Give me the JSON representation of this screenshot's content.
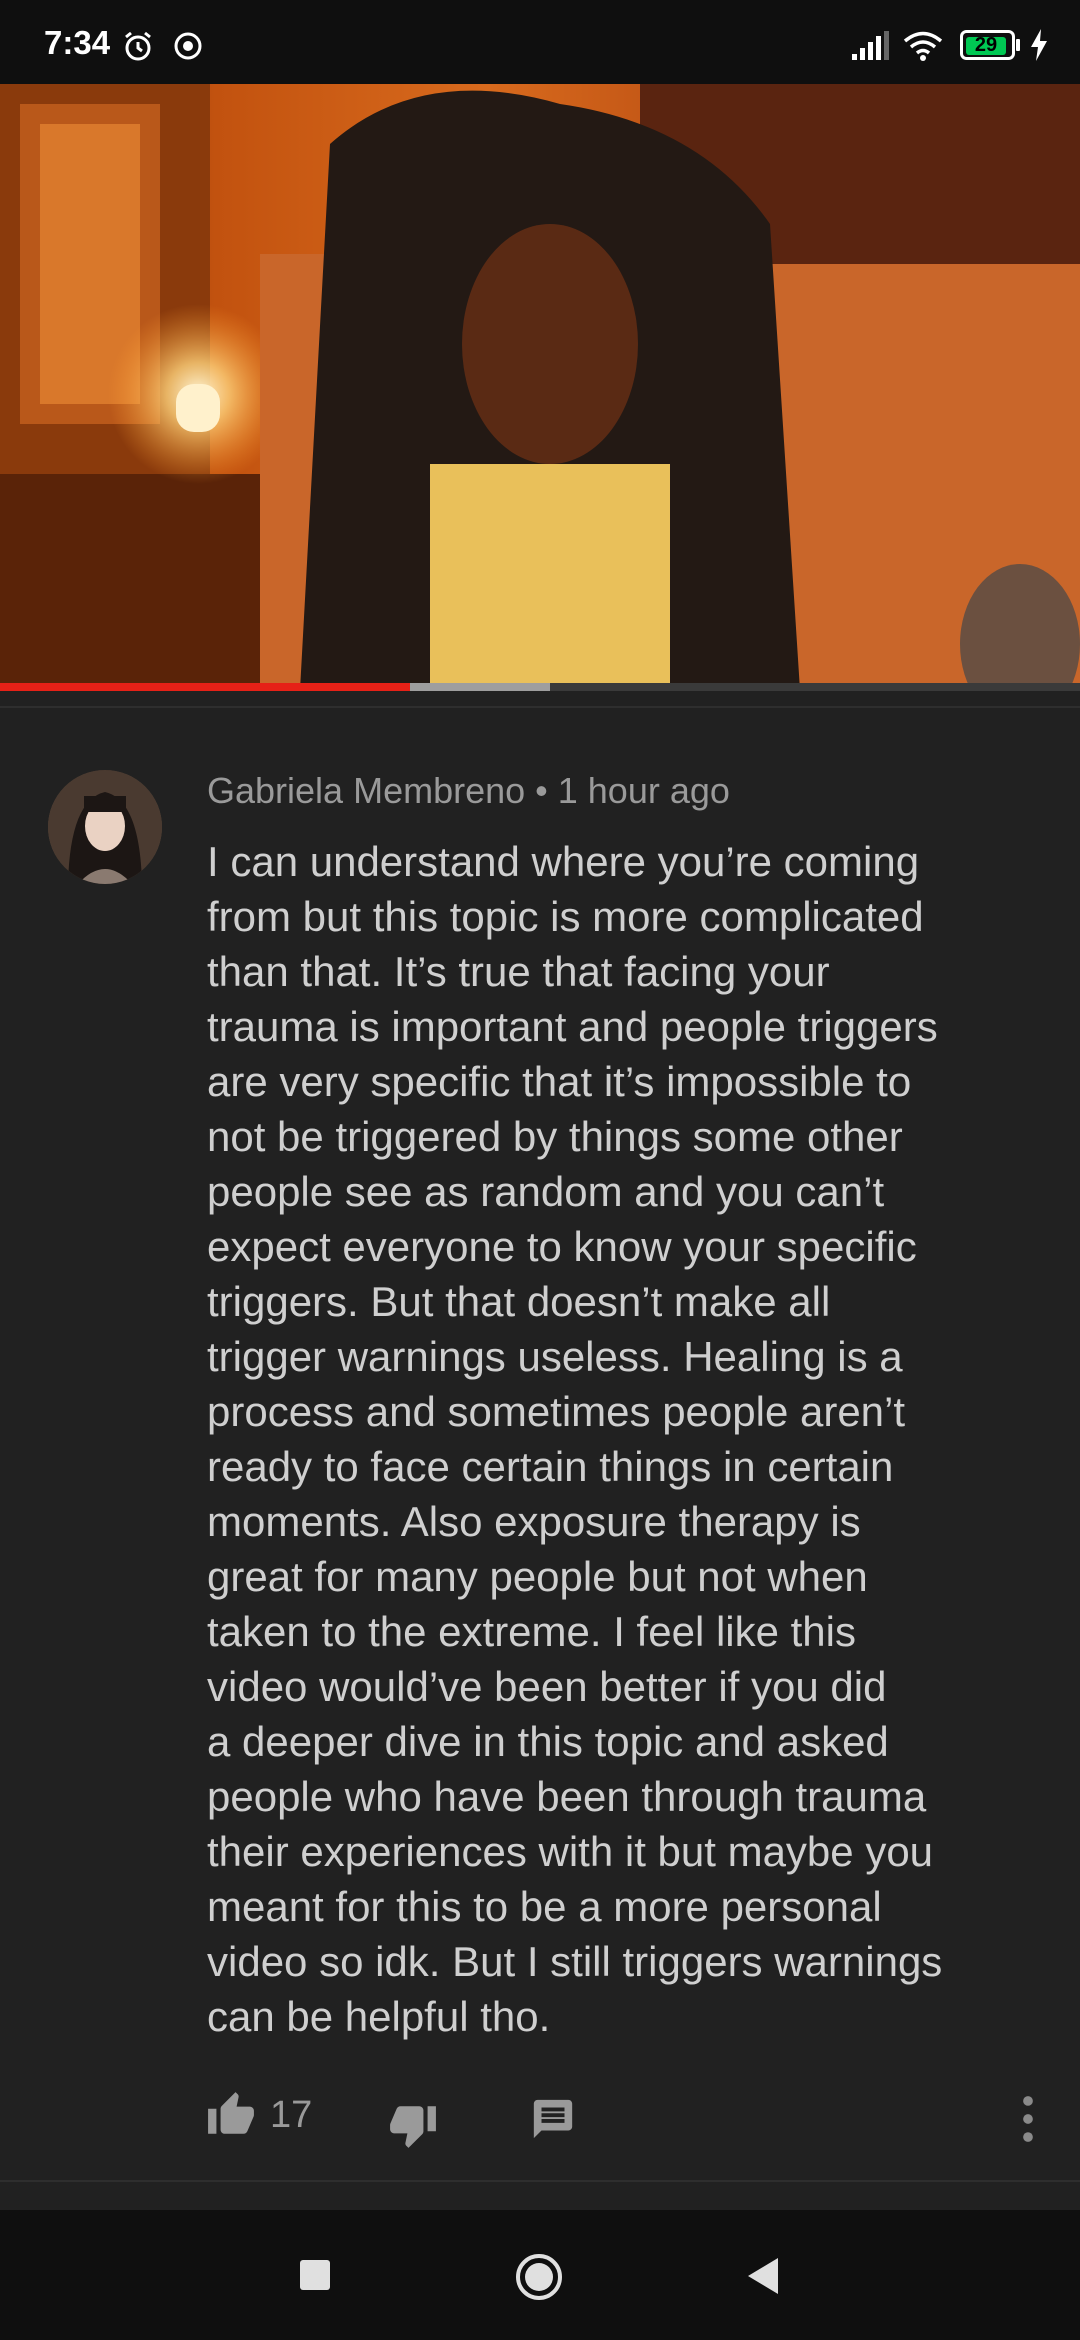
{
  "status_bar": {
    "time": "7:34",
    "battery": "29",
    "icons": [
      "alarm-icon",
      "assistant-icon",
      "signal-icon",
      "wifi-icon",
      "battery-icon",
      "charge-icon"
    ]
  },
  "video": {
    "progress_fraction": 0.38,
    "progress_color": "#e62117"
  },
  "comment": {
    "author": "Gabriela Membreno",
    "separator": " • ",
    "time_ago": "1 hour ago",
    "text": "I can understand where you’re coming\nfrom but this topic is more complicated\nthan that. It’s true that facing your\ntrauma is important and people triggers\nare very specific that it’s impossible to\nnot be triggered by things some other\npeople see as random and you can’t\nexpect everyone to know your specific\ntriggers. But that doesn’t make all\ntrigger warnings useless. Healing is a\nprocess and sometimes people aren’t\nready to face certain things in certain\nmoments. Also exposure therapy is\ngreat for many people but not when\ntaken to the extreme. I feel like this\nvideo would’ve been better if you did\na deeper dive in this topic and asked\npeople who have been through trauma\ntheir experiences with it but maybe you\nmeant for this to be a more personal\nvideo so idk. But I still triggers warnings\ncan be helpful tho.",
    "like_count": "17",
    "icons": [
      "like-icon",
      "dislike-icon",
      "reply-icon",
      "more-vert-icon"
    ]
  },
  "nav_bar": {
    "icons": [
      "recents-icon",
      "home-icon",
      "back-icon"
    ]
  }
}
